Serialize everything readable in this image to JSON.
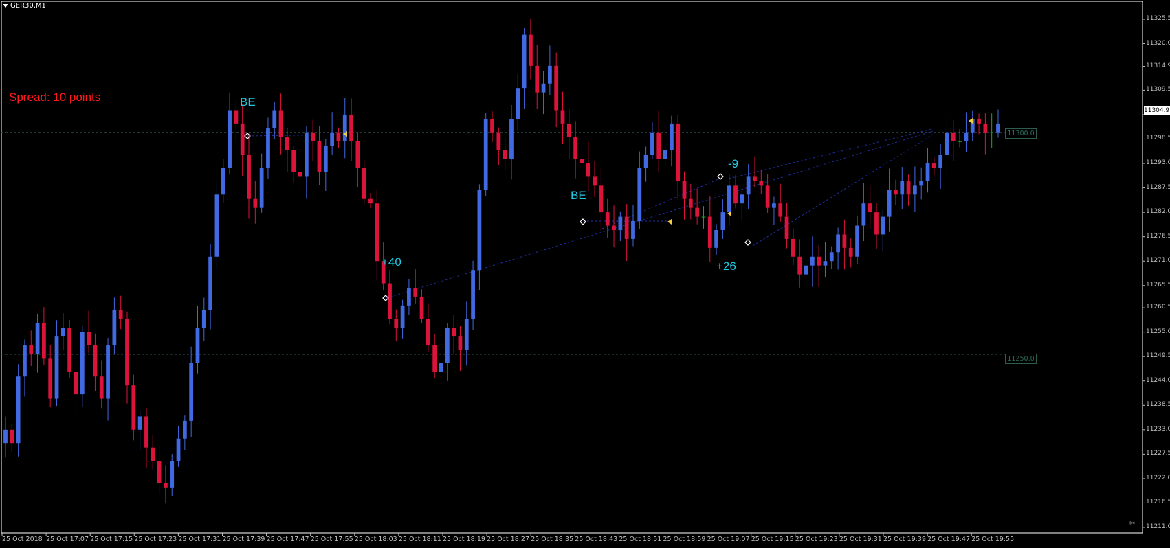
{
  "window": {
    "symbol_timeframe": "GER30,M1"
  },
  "overlay": {
    "spread": "Spread: 10 points"
  },
  "annotations": [
    {
      "text": "BE"
    },
    {
      "text": "+40"
    },
    {
      "text": "BE"
    },
    {
      "text": "-9"
    },
    {
      "text": "+26"
    }
  ],
  "price_axis": {
    "labels": [
      "11325.5",
      "11320.0",
      "11314.9",
      "11309.5",
      "11304.0",
      "11298.5",
      "11293.0",
      "11287.5",
      "11282.0",
      "11276.5",
      "11271.0",
      "11265.5",
      "11260.5",
      "11255.0",
      "11249.5",
      "11244.0",
      "11238.5",
      "11233.0",
      "11227.5",
      "11222.0",
      "11216.5",
      "11211.0"
    ],
    "current_price": "11304.9",
    "levels": [
      "11300.0",
      "11250.0"
    ]
  },
  "time_axis": {
    "labels": [
      "25 Oct 2018",
      "25 Oct 17:07",
      "25 Oct 17:15",
      "25 Oct 17:23",
      "25 Oct 17:31",
      "25 Oct 17:39",
      "25 Oct 17:47",
      "25 Oct 17:55",
      "25 Oct 18:03",
      "25 Oct 18:11",
      "25 Oct 18:19",
      "25 Oct 18:27",
      "25 Oct 18:35",
      "25 Oct 18:43",
      "25 Oct 18:51",
      "25 Oct 18:59",
      "25 Oct 19:07",
      "25 Oct 19:15",
      "25 Oct 19:23",
      "25 Oct 19:31",
      "25 Oct 19:39",
      "25 Oct 19:47",
      "25 Oct 19:55"
    ]
  },
  "colors": {
    "bull": "#4169e1",
    "bear": "#dc143c",
    "doji": "#22aa22",
    "grid": "#2f4f4f",
    "annotation": "#20c8e0",
    "trade_line": "#1e2ea0"
  },
  "chart_data": {
    "type": "candlestick",
    "title": "GER30,M1",
    "ylim": [
      11211.0,
      11325.5
    ],
    "y_scale": "linear",
    "close_path": [
      11233,
      11230,
      11245,
      11252,
      11250,
      11257,
      11249,
      11240,
      11254,
      11256,
      11246,
      11241,
      11255,
      11252,
      11245,
      11240,
      11252,
      11260,
      11258,
      11243,
      11233,
      11236,
      11229,
      11226,
      11221,
      11220,
      11226,
      11231,
      11235,
      11248,
      11256,
      11260,
      11272,
      11286,
      11292,
      11305,
      11302,
      11295,
      11285,
      11283,
      11292,
      11301,
      11305,
      11299,
      11296,
      11291,
      11290,
      11300,
      11298,
      11291,
      11297,
      11300,
      11298,
      11304,
      11298,
      11292,
      11285,
      11284,
      11271,
      11266,
      11258,
      11256,
      11261,
      11265,
      11263,
      11258,
      11252,
      11246,
      11248,
      11256,
      11254,
      11251,
      11258,
      11269,
      11287,
      11303,
      11300,
      11296,
      11294,
      11303,
      11310,
      11322,
      11315,
      11309,
      11311,
      11315,
      11305,
      11302,
      11299,
      11294,
      11293,
      11290,
      11288,
      11282,
      11279,
      11278,
      11281,
      11276,
      11280,
      11292,
      11295,
      11300,
      11294,
      11296,
      11302,
      11289,
      11285,
      11283,
      11281,
      11281,
      11274,
      11278,
      11282,
      11288,
      11284,
      11286,
      11290,
      11289,
      11288,
      11283,
      11284,
      11281,
      11276,
      11272,
      11268,
      11270,
      11272,
      11270,
      11271,
      11273,
      11277,
      11274,
      11272,
      11279,
      11284,
      11282,
      11277,
      11281,
      11287,
      11286,
      11289,
      11286,
      11288,
      11289,
      11293,
      11292,
      11295,
      11300,
      11298,
      11298,
      11300,
      11303,
      11302,
      11300,
      11300,
      11302
    ]
  }
}
